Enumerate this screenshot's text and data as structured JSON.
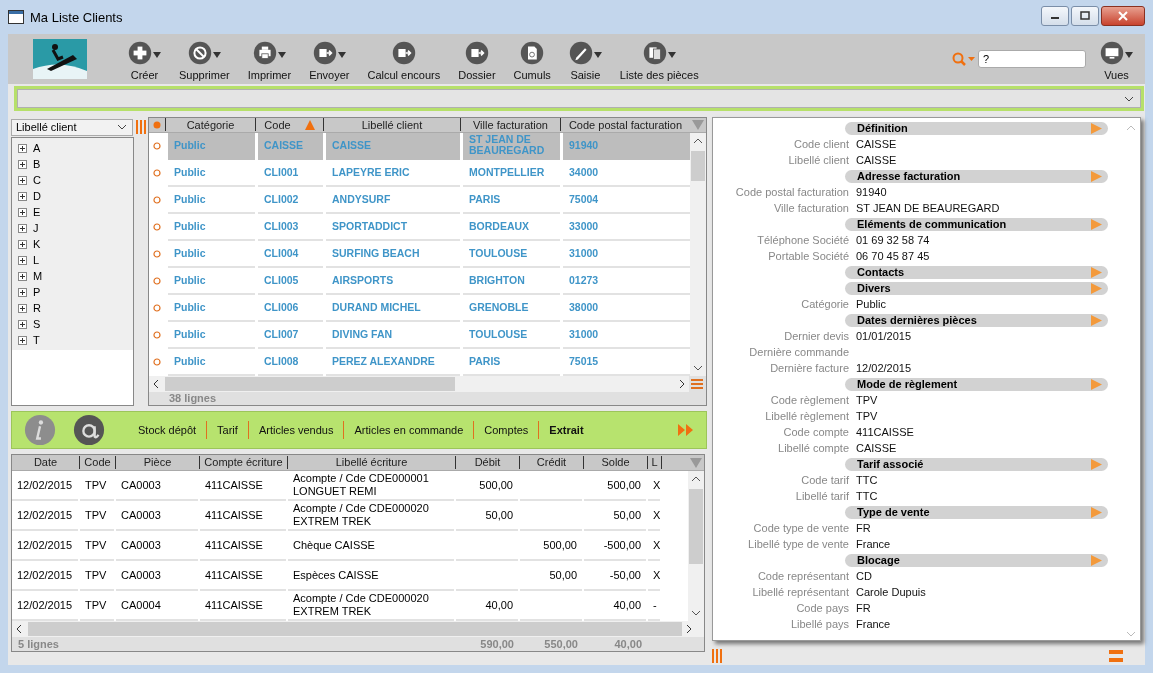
{
  "window": {
    "title": "Ma Liste Clients"
  },
  "toolbar": {
    "buttons": [
      {
        "label": "Créer",
        "menu": true
      },
      {
        "label": "Supprimer",
        "menu": true
      },
      {
        "label": "Imprimer",
        "menu": true
      },
      {
        "label": "Envoyer",
        "menu": true
      },
      {
        "label": "Calcul encours",
        "menu": false
      },
      {
        "label": "Dossier",
        "menu": false
      },
      {
        "label": "Cumuls",
        "menu": false
      },
      {
        "label": "Saisie",
        "menu": true
      },
      {
        "label": "Liste des pièces",
        "menu": true
      }
    ],
    "search": {
      "value": "?"
    },
    "views": {
      "label": "Vues"
    }
  },
  "tree": {
    "selector": "Libellé client",
    "items": [
      {
        "label": "A",
        "expanded": false
      },
      {
        "label": "B",
        "expanded": false
      },
      {
        "label": "C",
        "expanded": false
      },
      {
        "label": "D",
        "expanded": false
      },
      {
        "label": "E",
        "expanded": false
      },
      {
        "label": "J",
        "expanded": false
      },
      {
        "label": "K",
        "expanded": false
      },
      {
        "label": "L",
        "expanded": false
      },
      {
        "label": "M",
        "expanded": false
      },
      {
        "label": "P",
        "expanded": false
      },
      {
        "label": "R",
        "expanded": false
      },
      {
        "label": "S",
        "expanded": false
      },
      {
        "label": "T",
        "expanded": false
      }
    ]
  },
  "clients": {
    "columns": [
      {
        "label": "Catégorie",
        "sorted": false
      },
      {
        "label": "Code",
        "sorted": true
      },
      {
        "label": "Libellé client",
        "sorted": false
      },
      {
        "label": "Ville facturation",
        "sorted": false
      },
      {
        "label": "Code postal facturation",
        "sorted": false
      }
    ],
    "rows": [
      {
        "selected": true,
        "cells": [
          "Public",
          "CAISSE",
          "CAISSE",
          "ST JEAN DE BEAUREGARD",
          "91940"
        ]
      },
      {
        "selected": false,
        "cells": [
          "Public",
          "CLI001",
          "LAPEYRE ERIC",
          "MONTPELLIER",
          "34000"
        ]
      },
      {
        "selected": false,
        "cells": [
          "Public",
          "CLI002",
          "ANDYSURF",
          "PARIS",
          "75004"
        ]
      },
      {
        "selected": false,
        "cells": [
          "Public",
          "CLI003",
          "SPORTADDICT",
          "BORDEAUX",
          "33000"
        ]
      },
      {
        "selected": false,
        "cells": [
          "Public",
          "CLI004",
          "SURFING BEACH",
          "TOULOUSE",
          "31000"
        ]
      },
      {
        "selected": false,
        "cells": [
          "Public",
          "CLI005",
          "AIRSPORTS",
          "BRIGHTON",
          "01273"
        ]
      },
      {
        "selected": false,
        "cells": [
          "Public",
          "CLI006",
          "DURAND MICHEL",
          "GRENOBLE",
          "38000"
        ]
      },
      {
        "selected": false,
        "cells": [
          "Public",
          "CLI007",
          "DIVING FAN",
          "TOULOUSE",
          "31000"
        ]
      },
      {
        "selected": false,
        "cells": [
          "Public",
          "CLI008",
          "PEREZ ALEXANDRE",
          "PARIS",
          "75015"
        ]
      }
    ],
    "footer": "38 lignes"
  },
  "tabs": [
    {
      "label": "Stock dépôt",
      "selected": false
    },
    {
      "label": "Tarif",
      "selected": false
    },
    {
      "label": "Articles vendus",
      "selected": false
    },
    {
      "label": "Articles en commande",
      "selected": false
    },
    {
      "label": "Comptes",
      "selected": false
    },
    {
      "label": "Extrait",
      "selected": true
    }
  ],
  "entries": {
    "columns": [
      "Date",
      "Code",
      "Pièce",
      "Compte écriture",
      "Libellé écriture",
      "Débit",
      "Crédit",
      "Solde",
      "L"
    ],
    "rows": [
      {
        "cells": [
          "12/02/2015",
          "TPV",
          "CA0003",
          "411CAISSE",
          "Acompte / Cde CDE000001 LONGUET REMI",
          "500,00",
          "",
          "500,00",
          "X"
        ]
      },
      {
        "cells": [
          "12/02/2015",
          "TPV",
          "CA0003",
          "411CAISSE",
          "Acompte / Cde CDE000020 EXTREM TREK",
          "50,00",
          "",
          "50,00",
          "X"
        ]
      },
      {
        "cells": [
          "12/02/2015",
          "TPV",
          "CA0003",
          "411CAISSE",
          "Chèque CAISSE",
          "",
          "500,00",
          "-500,00",
          "X"
        ]
      },
      {
        "cells": [
          "12/02/2015",
          "TPV",
          "CA0003",
          "411CAISSE",
          "Espèces CAISSE",
          "",
          "50,00",
          "-50,00",
          "X"
        ]
      },
      {
        "cells": [
          "12/02/2015",
          "TPV",
          "CA0004",
          "411CAISSE",
          "Acompte / Cde CDE000020 EXTREM TREK",
          "40,00",
          "",
          "40,00",
          "-"
        ]
      }
    ],
    "footer": {
      "count": "5 lignes",
      "debit": "590,00",
      "credit": "550,00",
      "solde": "40,00"
    }
  },
  "details": {
    "sections": [
      {
        "title": "Définition",
        "fields": [
          {
            "label": "Code client",
            "value": "CAISSE"
          },
          {
            "label": "Libellé client",
            "value": "CAISSE"
          }
        ]
      },
      {
        "title": "Adresse facturation",
        "fields": [
          {
            "label": "Code postal facturation",
            "value": "91940"
          },
          {
            "label": "Ville facturation",
            "value": "ST JEAN DE BEAUREGARD"
          }
        ]
      },
      {
        "title": "Eléments de communication",
        "fields": [
          {
            "label": "Téléphone Société",
            "value": "01 69 32 58 74"
          },
          {
            "label": "Portable Société",
            "value": "06 70 45 87 45"
          }
        ]
      },
      {
        "title": "Contacts"
      },
      {
        "title": "Divers",
        "fields": [
          {
            "label": "Catégorie",
            "value": "Public"
          }
        ]
      },
      {
        "title": "Dates dernières pièces",
        "fields": [
          {
            "label": "Dernier devis",
            "value": "01/01/2015"
          },
          {
            "label": "Dernière commande"
          },
          {
            "label": "Dernière facture",
            "value": "12/02/2015"
          }
        ]
      },
      {
        "title": "Mode de règlement",
        "fields": [
          {
            "label": "Code règlement",
            "value": "TPV"
          },
          {
            "label": "Libellé règlement",
            "value": "TPV"
          },
          {
            "label": "Code compte",
            "value": "411CAISSE"
          },
          {
            "label": "Libellé compte",
            "value": "CAISSE"
          }
        ]
      },
      {
        "title": "Tarif associé",
        "fields": [
          {
            "label": "Code tarif",
            "value": "TTC"
          },
          {
            "label": "Libellé tarif",
            "value": "TTC"
          }
        ]
      },
      {
        "title": "Type de vente",
        "fields": [
          {
            "label": "Code type de vente",
            "value": "FR"
          },
          {
            "label": "Libellé type de vente",
            "value": "France"
          }
        ]
      },
      {
        "title": "Blocage",
        "fields": [
          {
            "label": "Code représentant",
            "value": "CD"
          },
          {
            "label": "Libellé représentant",
            "value": "Carole Dupuis"
          },
          {
            "label": "Code pays",
            "value": "FR"
          },
          {
            "label": "Libellé pays",
            "value": "France"
          }
        ]
      }
    ]
  }
}
